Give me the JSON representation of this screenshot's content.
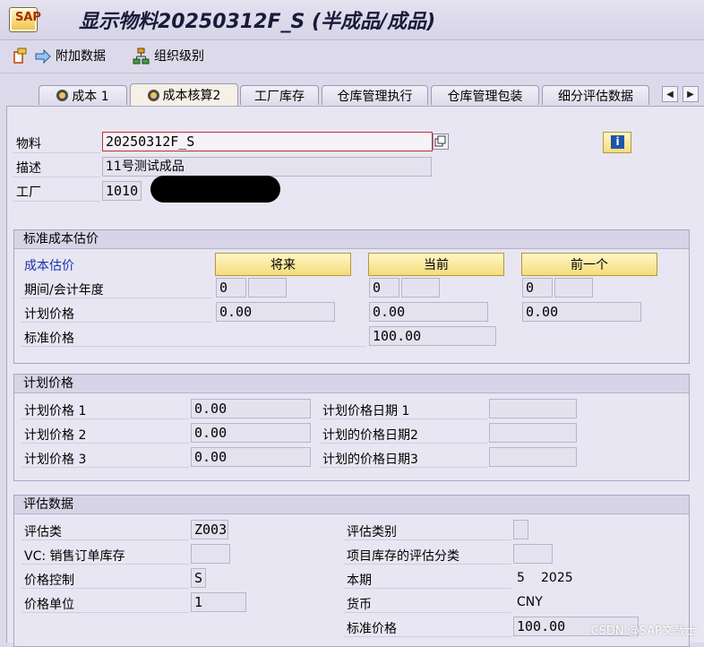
{
  "window": {
    "title": "显示物料20250312F_S (半成品/成品)",
    "icon_text": "SAP"
  },
  "toolbar": {
    "additional_data": "附加数据",
    "org_levels": "组织级别"
  },
  "tabs": [
    "成本 1",
    "成本核算2",
    "工厂库存",
    "仓库管理执行",
    "仓库管理包装",
    "细分评估数据"
  ],
  "header": {
    "material_label": "物料",
    "material_value": "20250312F_S",
    "desc_label": "描述",
    "desc_value": "11号测试成品",
    "plant_label": "工厂",
    "plant_value": "1010"
  },
  "std_cost_estimate": {
    "title": "标准成本估价",
    "cost_estimate_label": "成本估价",
    "buttons": [
      "将来",
      "当前",
      "前一个"
    ],
    "period_label": "期间/会计年度",
    "periods": [
      "0",
      "0",
      "0"
    ],
    "planned_price_label": "计划价格",
    "planned_prices": [
      "0.00",
      "0.00",
      "0.00"
    ],
    "std_price_label": "标准价格",
    "std_price_value": "100.00"
  },
  "planned_price": {
    "title": "计划价格",
    "rows": [
      {
        "label": "计划价格 1",
        "value": "0.00",
        "date_label": "计划价格日期 1",
        "date_value": ""
      },
      {
        "label": "计划价格 2",
        "value": "0.00",
        "date_label": "计划的价格日期2",
        "date_value": ""
      },
      {
        "label": "计划价格 3",
        "value": "0.00",
        "date_label": "计划的价格日期3",
        "date_value": ""
      }
    ]
  },
  "valuation": {
    "title": "评估数据",
    "val_class_label": "评估类",
    "val_class_value": "Z003",
    "vc_label": "VC: 销售订单库存",
    "vc_value": "",
    "price_control_label": "价格控制",
    "price_control_value": "S",
    "price_unit_label": "价格单位",
    "price_unit_value": "1",
    "val_category_label": "评估类别",
    "val_category_value": "",
    "proj_stock_label": "项目库存的评估分类",
    "proj_stock_value": "",
    "current_period_label": "本期",
    "current_period_value": "5",
    "current_year_value": "2025",
    "currency_label": "货币",
    "currency_value": "CNY",
    "std_price_label": "标准价格",
    "std_price_value": "100.00"
  },
  "watermark": "CSDN @SAP文哉士"
}
